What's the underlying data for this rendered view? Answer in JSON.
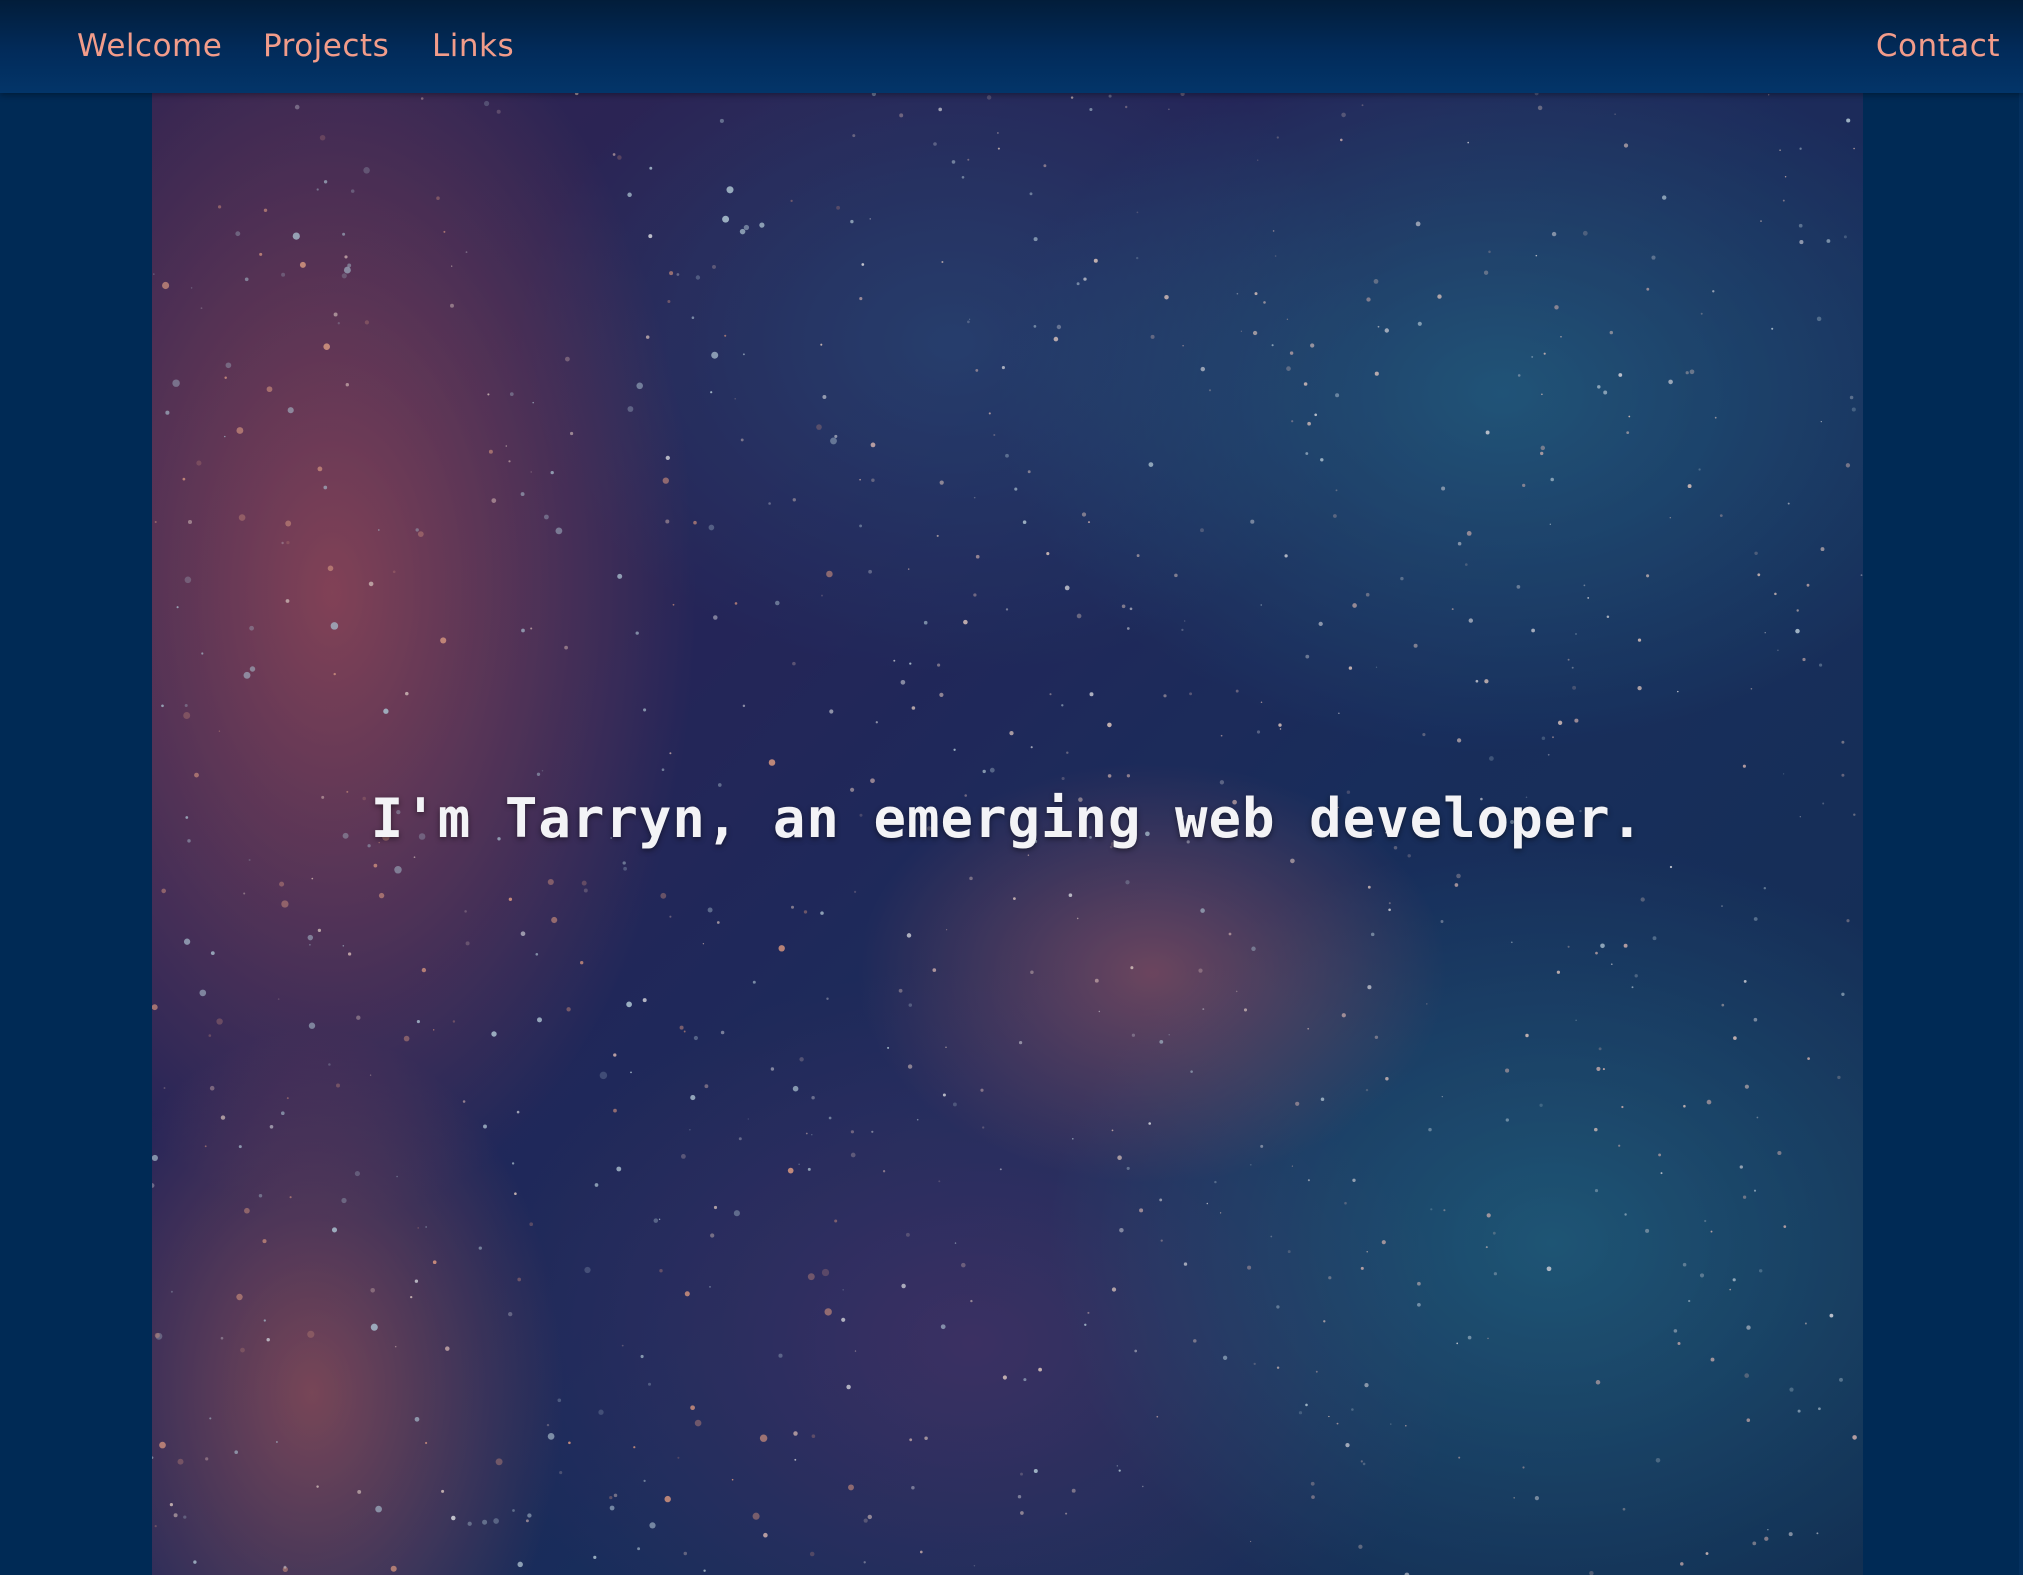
{
  "nav": {
    "welcome": "Welcome",
    "projects": "Projects",
    "links": "Links",
    "contact": "Contact"
  },
  "hero": {
    "headline": "I'm Tarryn, an emerging web developer.",
    "background": "galaxy-texture-image"
  },
  "colors": {
    "page_background": "#002a55",
    "nav_background": "#022b5a",
    "nav_link": "#f29c8a",
    "headline_text": "#f3f3f6"
  }
}
